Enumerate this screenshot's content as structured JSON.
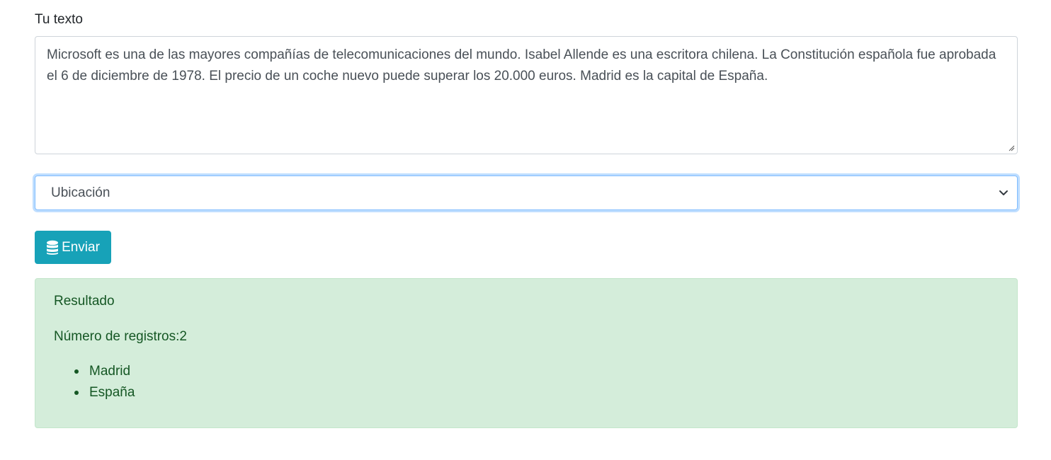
{
  "form": {
    "text_label": "Tu texto",
    "text_value": "Microsoft es una de las mayores compañías de telecomunicaciones del mundo. Isabel Allende es una escritora chilena. La Constitución española fue aprobada el 6 de diciembre de 1978. El precio de un coche nuevo puede superar los 20.000 euros. Madrid es la capital de España.",
    "entity_select": {
      "selected": "Ubicación"
    },
    "submit_button": {
      "label": "Enviar",
      "icon": "database-icon",
      "color": "#17a2b8"
    }
  },
  "result": {
    "title": "Resultado",
    "count_label": "Número de registros:2",
    "items": [
      "Madrid",
      "España"
    ],
    "background_color": "#d4edda",
    "text_color": "#155724"
  }
}
